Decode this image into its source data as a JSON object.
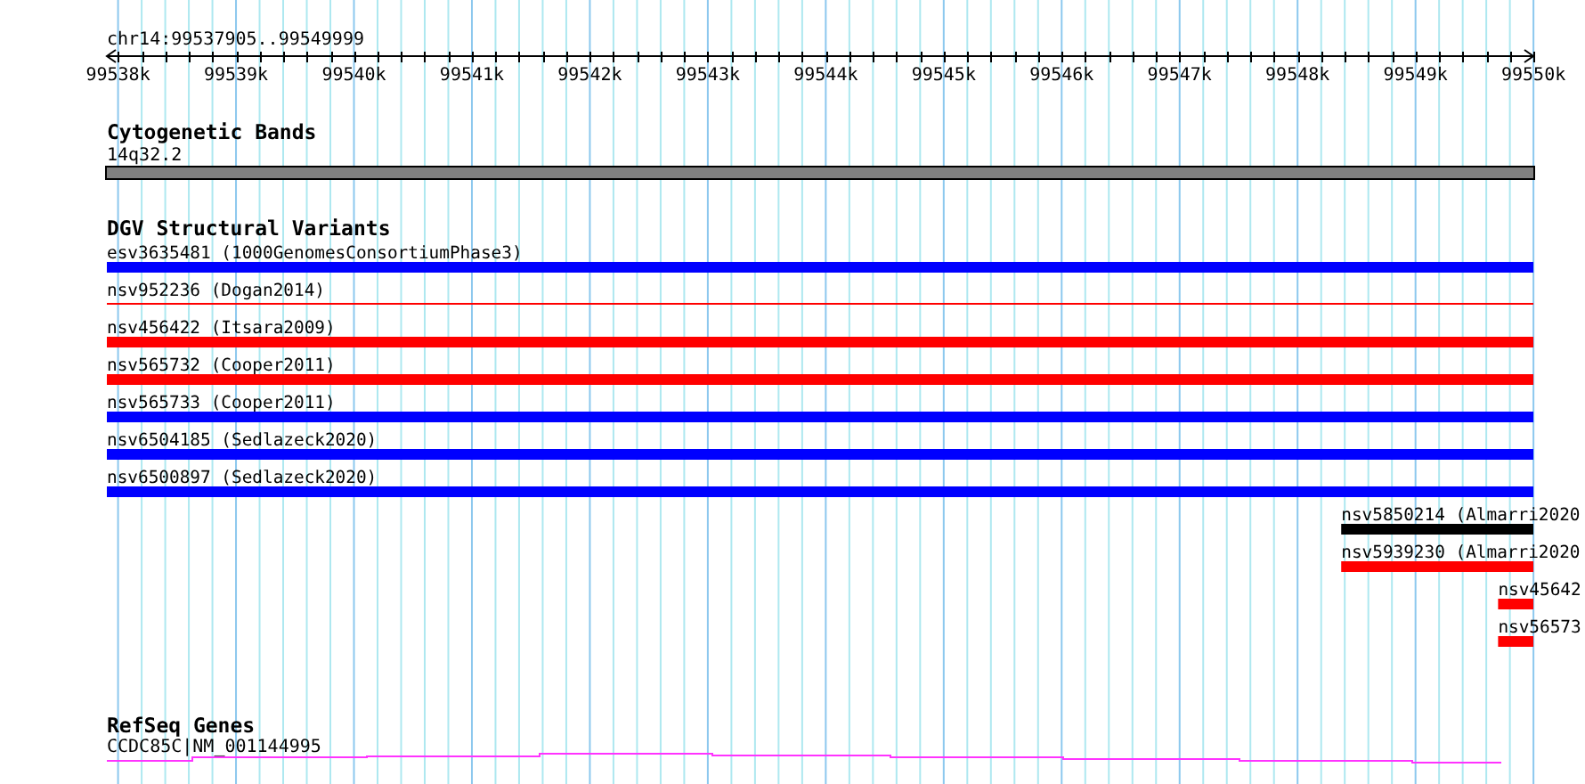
{
  "region": {
    "label": "chr14:99537905..99549999"
  },
  "ruler": {
    "ticks": [
      "99538k",
      "99539k",
      "99540k",
      "99541k",
      "99542k",
      "99543k",
      "99544k",
      "99545k",
      "99546k",
      "99547k",
      "99548k",
      "99549k",
      "99550k"
    ]
  },
  "cytoband_track": {
    "title": "Cytogenetic Bands",
    "band": "14q32.2"
  },
  "variant_track": {
    "title": "DGV Structural Variants",
    "features": [
      {
        "label": "esv3635481 (1000GenomesConsortiumPhase3)",
        "color": "#0000ff",
        "kind": "thick"
      },
      {
        "label": "nsv952236 (Dogan2014)",
        "color": "#ff0000",
        "kind": "thin"
      },
      {
        "label": "nsv456422 (Itsara2009)",
        "color": "#ff0000",
        "kind": "thick"
      },
      {
        "label": "nsv565732 (Cooper2011)",
        "color": "#ff0000",
        "kind": "thick"
      },
      {
        "label": "nsv565733 (Cooper2011)",
        "color": "#0000ff",
        "kind": "thick"
      },
      {
        "label": "nsv6504185 (Sedlazeck2020)",
        "color": "#0000ff",
        "kind": "thick"
      },
      {
        "label": "nsv6500897 (Sedlazeck2020)",
        "color": "#0000ff",
        "kind": "thick"
      },
      {
        "label": "nsv5850214 (Almarri2020",
        "color": "#000000",
        "kind": "thick"
      },
      {
        "label": "nsv5939230 (Almarri2020",
        "color": "#ff0000",
        "kind": "thick"
      },
      {
        "label": "nsv45642",
        "color": "#ff0000",
        "kind": "thick"
      },
      {
        "label": "nsv56573",
        "color": "#ff0000",
        "kind": "thick"
      }
    ]
  },
  "gene_track": {
    "title": "RefSeq Genes",
    "gene": "CCDC85C|NM_001144995"
  }
}
